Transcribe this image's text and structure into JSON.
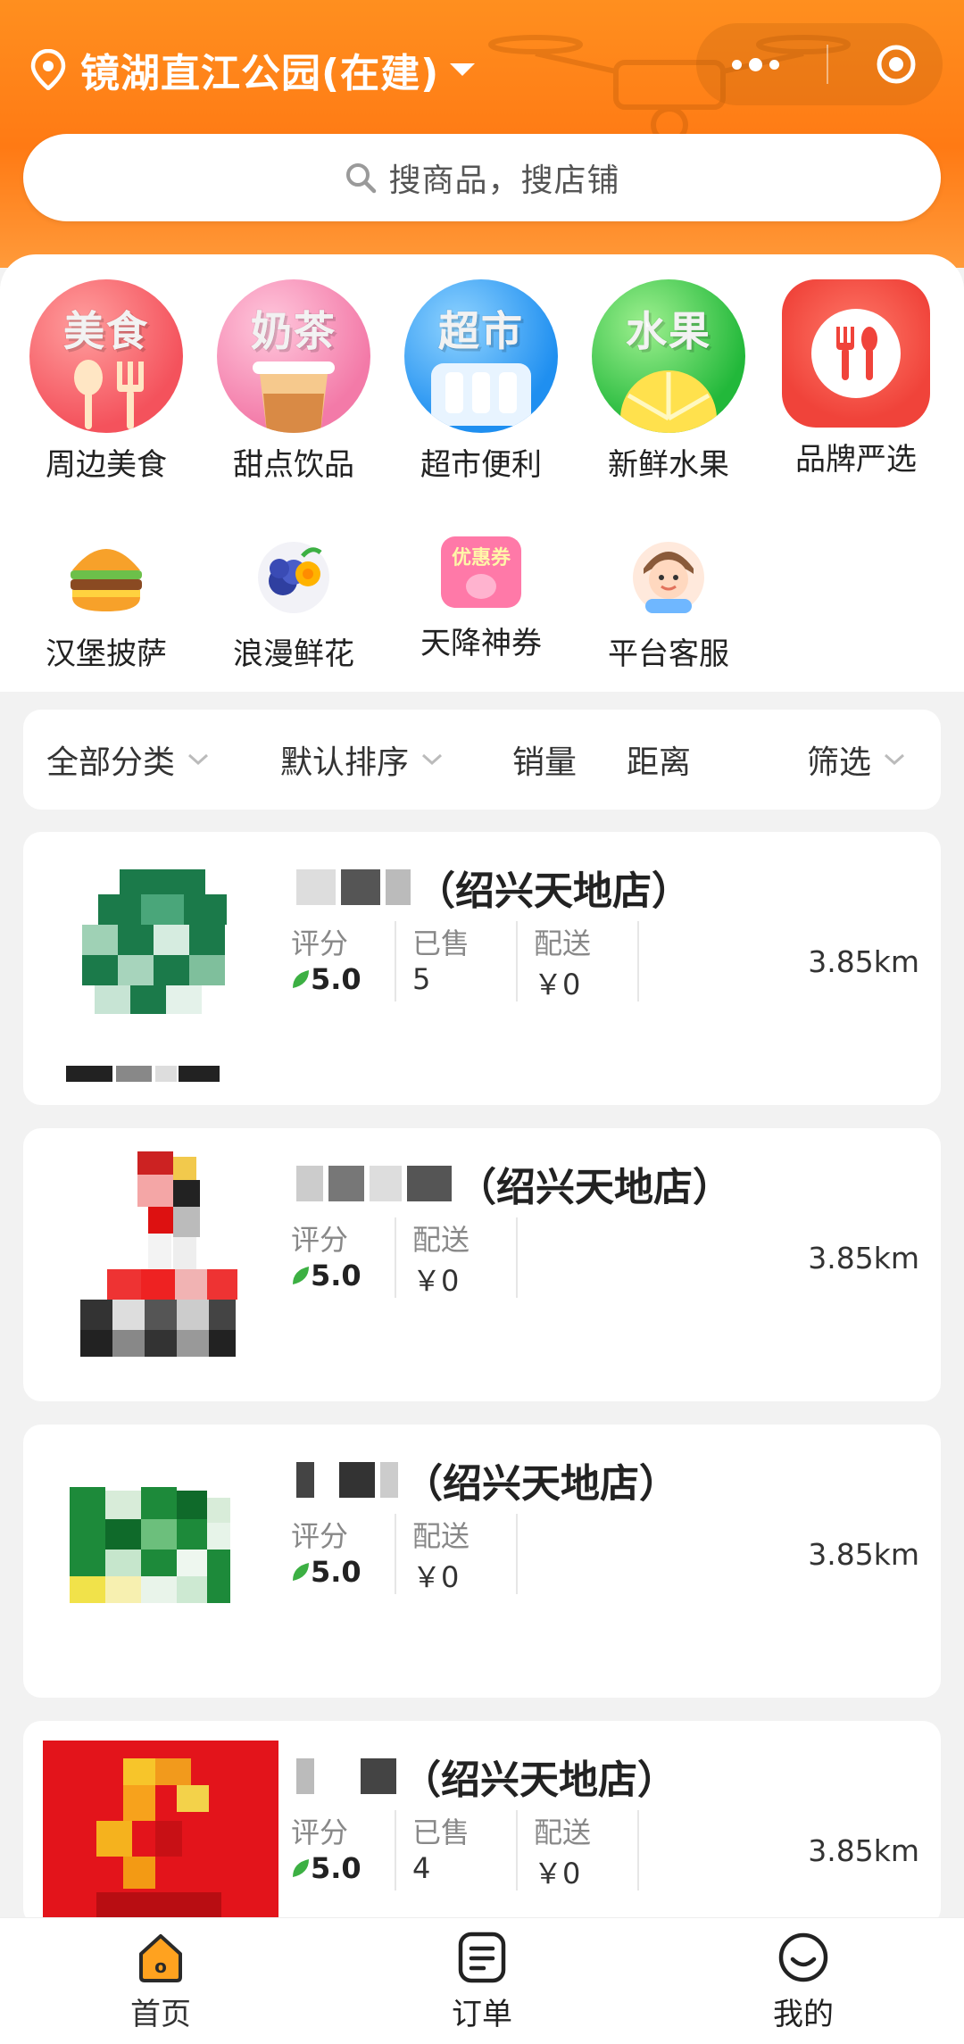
{
  "header": {
    "location": "镜湖直江公园(在建)",
    "search_placeholder": "搜商品，搜店铺"
  },
  "categories": [
    {
      "label": "周边美食",
      "badge": "美食",
      "icon": "food-icon"
    },
    {
      "label": "甜点饮品",
      "badge": "奶茶",
      "icon": "milk-tea-icon"
    },
    {
      "label": "超市便利",
      "badge": "超市",
      "icon": "supermarket-icon"
    },
    {
      "label": "新鲜水果",
      "badge": "水果",
      "icon": "fruit-icon"
    },
    {
      "label": "品牌严选",
      "badge": "",
      "icon": "fork-spoon-icon"
    },
    {
      "label": "汉堡披萨",
      "icon": "burger-icon"
    },
    {
      "label": "浪漫鲜花",
      "icon": "flower-icon"
    },
    {
      "label": "天降神券",
      "badge": "优惠券",
      "icon": "coupon-icon"
    },
    {
      "label": "平台客服",
      "icon": "customer-service-icon"
    }
  ],
  "filters": [
    {
      "label": "全部分类",
      "has_dropdown": true
    },
    {
      "label": "默认排序",
      "has_dropdown": true
    },
    {
      "label": "销量",
      "has_dropdown": false
    },
    {
      "label": "距离",
      "has_dropdown": false
    },
    {
      "label": "筛选",
      "has_dropdown": true
    }
  ],
  "stores": [
    {
      "name_suffix": "（绍兴天地店）",
      "rating_label": "评分",
      "rating": "5.0",
      "sold_label": "已售",
      "sold": "5",
      "delivery_label": "配送",
      "delivery": "￥0",
      "distance": "3.85km"
    },
    {
      "name_suffix": "（绍兴天地店）",
      "rating_label": "评分",
      "rating": "5.0",
      "delivery_label": "配送",
      "delivery": "￥0",
      "distance": "3.85km"
    },
    {
      "name_suffix": "（绍兴天地店）",
      "rating_label": "评分",
      "rating": "5.0",
      "delivery_label": "配送",
      "delivery": "￥0",
      "distance": "3.85km"
    },
    {
      "name_suffix": "（绍兴天地店）",
      "rating_label": "评分",
      "rating": "5.0",
      "sold_label": "已售",
      "sold": "4",
      "delivery_label": "配送",
      "delivery": "￥0",
      "distance": "3.85km"
    }
  ],
  "tabbar": [
    {
      "label": "首页",
      "icon": "home-icon",
      "active": true
    },
    {
      "label": "订单",
      "icon": "order-icon",
      "active": false
    },
    {
      "label": "我的",
      "icon": "profile-icon",
      "active": false
    }
  ],
  "colors": {
    "brand": "#ff7a14",
    "rating_leaf": "#3cb043"
  }
}
